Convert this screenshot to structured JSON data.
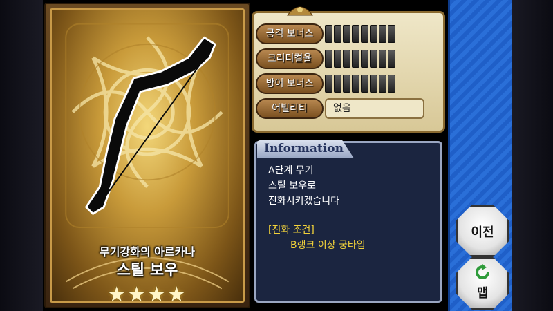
{
  "card": {
    "subtitle": "무기강화의 아르카나",
    "name": "스틸 보우",
    "stars": "★★★★"
  },
  "stats": [
    {
      "label": "공격 보너스",
      "bars": 8
    },
    {
      "label": "크리티컬율",
      "bars": 8
    },
    {
      "label": "방어 보너스",
      "bars": 8
    }
  ],
  "ability": {
    "label": "어빌리티",
    "value": "없음"
  },
  "info": {
    "tab": "Information",
    "line1": "A단계 무기",
    "line2": "스틸 보우로",
    "line3": "진화시키겠습니다",
    "cond_title": "[진화 조건]",
    "cond_item": "B랭크 이상 궁타입"
  },
  "buttons": {
    "prev": "이전",
    "map": "맵",
    "map_icon": "refresh-arrow-icon"
  },
  "colors": {
    "info_text": "#ffffff",
    "condition_text": "#f2d23a",
    "map_icon": "#2e9b3a"
  }
}
